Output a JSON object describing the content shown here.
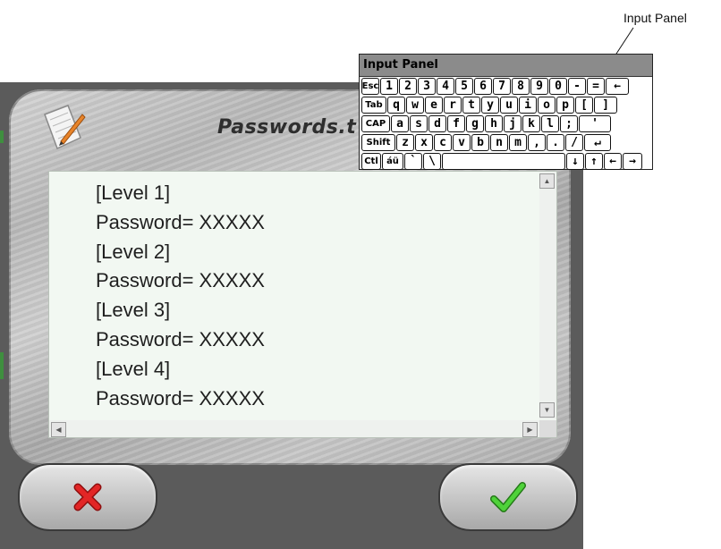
{
  "callout": {
    "label": "Input Panel"
  },
  "dialog": {
    "title": "Passwords.t",
    "content_lines": [
      "[Level 1]",
      "Password= XXXXX",
      "[Level 2]",
      "Password= XXXXX",
      "[Level 3]",
      "Password= XXXXX",
      "[Level 4]",
      "Password= XXXXX"
    ],
    "buttons": {
      "cancel_icon": "red-x-icon",
      "ok_icon": "green-check-icon"
    }
  },
  "input_panel": {
    "title": "Input Panel",
    "rows": [
      [
        "Esc",
        "1",
        "2",
        "3",
        "4",
        "5",
        "6",
        "7",
        "8",
        "9",
        "0",
        "-",
        "=",
        "←"
      ],
      [
        "Tab",
        "q",
        "w",
        "e",
        "r",
        "t",
        "y",
        "u",
        "i",
        "o",
        "p",
        "[",
        "]"
      ],
      [
        "CAP",
        "a",
        "s",
        "d",
        "f",
        "g",
        "h",
        "j",
        "k",
        "l",
        ";",
        "'"
      ],
      [
        "Shift",
        "z",
        "x",
        "c",
        "v",
        "b",
        "n",
        "m",
        ",",
        ".",
        "/",
        "↵"
      ],
      [
        "Ctl",
        "áü",
        "`",
        "\\",
        " ",
        "↓",
        "↑",
        "←",
        "→"
      ]
    ]
  },
  "colors": {
    "content_bg": "#f2f8f2",
    "frame": "#c4c4c4",
    "ok_green": "#3fb82b",
    "cancel_red": "#d81e1e"
  }
}
